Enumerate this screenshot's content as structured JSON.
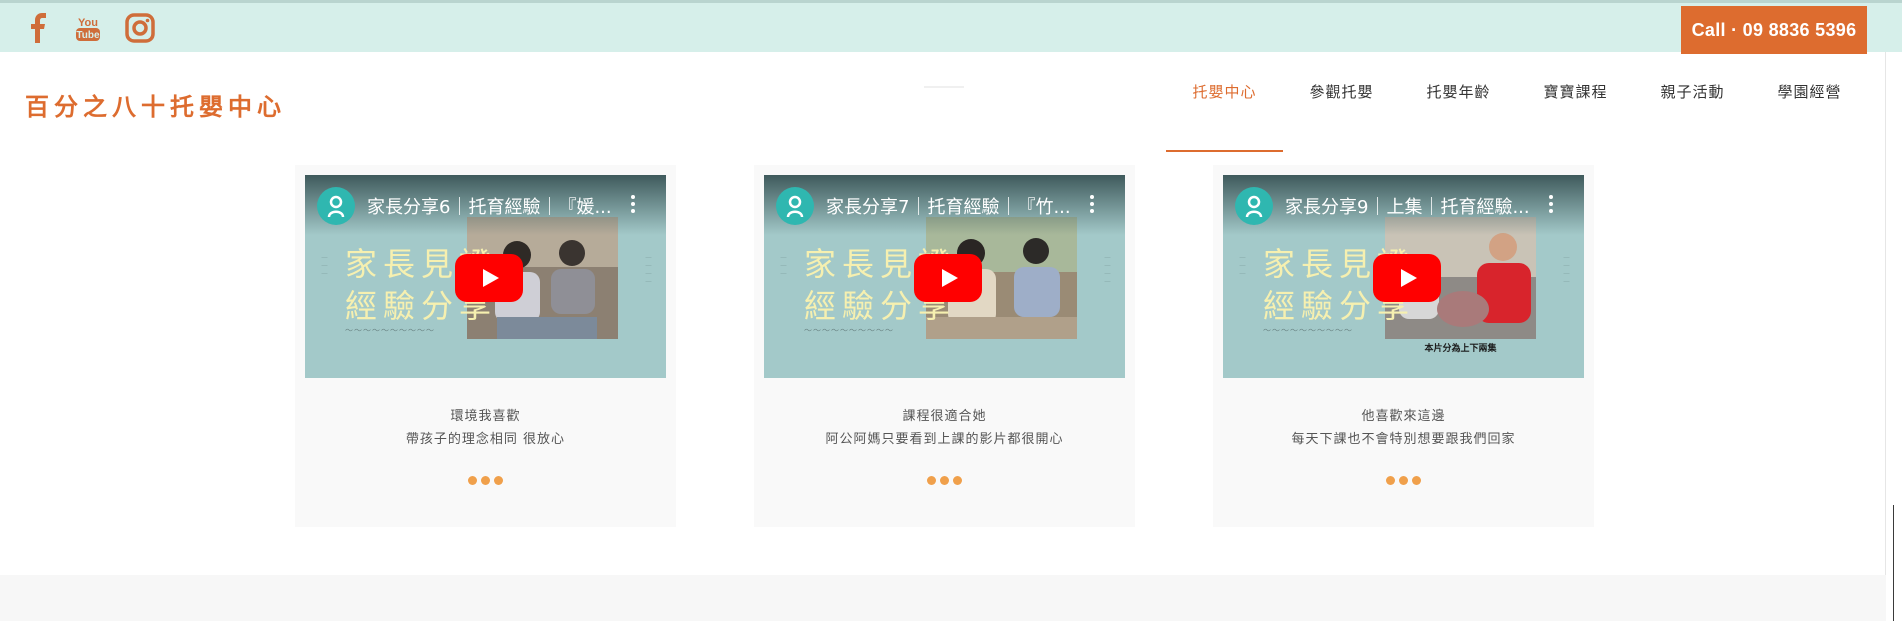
{
  "topbar": {
    "social": [
      {
        "name": "facebook-icon"
      },
      {
        "name": "youtube-icon",
        "text_top": "You",
        "text_bottom": "Tube"
      },
      {
        "name": "instagram-icon"
      }
    ],
    "call_label": "Call · 09 8836 5396",
    "accent": "#dd6c2f",
    "background": "#d6efea"
  },
  "header": {
    "logo_text": "百分之八十托嬰中心",
    "nav": [
      {
        "label": "托嬰中心",
        "active": true
      },
      {
        "label": "參觀托嬰"
      },
      {
        "label": "托嬰年齡"
      },
      {
        "label": "寶寶課程"
      },
      {
        "label": "親子活動"
      },
      {
        "label": "學園經營"
      }
    ]
  },
  "cards": [
    {
      "video_title": "家長分享6｜托育經驗｜『媛...",
      "thumb_line1": "家長見證",
      "thumb_line2": "經驗分享",
      "quote_line1": "環境我喜歡",
      "quote_line2": "帶孩子的理念相同 很放心"
    },
    {
      "video_title": "家長分享7｜托育經驗｜『竹...",
      "thumb_line1": "家長見證",
      "thumb_line2": "經驗分享",
      "quote_line1": "課程很適合她",
      "quote_line2": "阿公阿媽只要看到上課的影片都很開心"
    },
    {
      "video_title": "家長分享9｜上集｜托育經驗...",
      "thumb_line1": "家長見證",
      "thumb_line2": "經驗分享",
      "photo_caption": "本片分為上下兩集",
      "quote_line1": "他喜歡來這邊",
      "quote_line2": "每天下課也不會特別想要跟我們回家"
    }
  ],
  "colors": {
    "play_button": "#ff0000",
    "dots": "#f0a04b",
    "thumbnail_bg": "#a3c9c9"
  }
}
